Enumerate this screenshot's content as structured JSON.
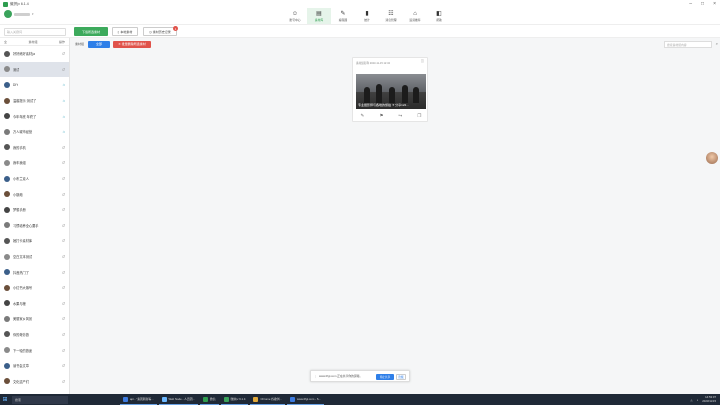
{
  "window": {
    "title": "微拼(v 6.1.4"
  },
  "header": {
    "tabs": [
      {
        "label": "账号中心",
        "icon": "person-icon",
        "glyph": "☺"
      },
      {
        "label": "素材库",
        "icon": "library-icon",
        "glyph": "▤",
        "active": true
      },
      {
        "label": "编辑器",
        "icon": "pen-icon",
        "glyph": "✎"
      },
      {
        "label": "统计",
        "icon": "chart-icon",
        "glyph": "▮"
      },
      {
        "label": "消息管理",
        "icon": "chat-icon",
        "glyph": "☷"
      },
      {
        "label": "运营推荐",
        "icon": "store-icon",
        "glyph": "⌂"
      },
      {
        "label": "帮助",
        "icon": "help-icon",
        "glyph": "◧"
      }
    ]
  },
  "toolbar": {
    "search_placeholder": "输入关键词",
    "primary_btn": "下载所选素材",
    "btn2": "本地素材",
    "btn3": "素材历史记录",
    "badge": "1"
  },
  "sidebar": {
    "col1": "全",
    "col2": "素材组",
    "col3": "操作",
    "items": [
      {
        "name": "好好练好素材(a",
        "status": "↺",
        "ok": false
      },
      {
        "name": "测试",
        "status": "↺",
        "ok": false
      },
      {
        "name": "DIY",
        "status": "⌂",
        "ok": true
      },
      {
        "name": "温馨提示 测试了",
        "status": "⌂",
        "ok": true
      },
      {
        "name": "今年年底 年终了",
        "status": "⌂",
        "ok": true
      },
      {
        "name": "万人城市经营",
        "status": "⌂",
        "ok": true
      },
      {
        "name": "我的手机",
        "status": "↺",
        "ok": false
      },
      {
        "name": "我车我组",
        "status": "↺",
        "ok": false
      },
      {
        "name": "小布兰克人",
        "status": "↺",
        "ok": false
      },
      {
        "name": "小钢炮",
        "status": "↺",
        "ok": false
      },
      {
        "name": "梦想手册",
        "status": "↺",
        "ok": false
      },
      {
        "name": "习惯培养全心要手",
        "status": "↺",
        "ok": false
      },
      {
        "name": "她打卡素材库",
        "status": "↺",
        "ok": false
      },
      {
        "name": "空白文本测试",
        "status": "↺",
        "ok": false
      },
      {
        "name": "抖音热门了",
        "status": "↺",
        "ok": false
      },
      {
        "name": "小红书大咖号",
        "status": "↺",
        "ok": false
      },
      {
        "name": "水果与粮",
        "status": "↺",
        "ok": false
      },
      {
        "name": "美丽家乡风景",
        "status": "↺",
        "ok": false
      },
      {
        "name": "你的奇妙旅",
        "status": "↺",
        "ok": false
      },
      {
        "name": "下一轮的旅途",
        "status": "↺",
        "ok": false
      },
      {
        "name": "读书会文章",
        "status": "↺",
        "ok": false
      },
      {
        "name": "文化遗产们",
        "status": "↺",
        "ok": false
      }
    ]
  },
  "main": {
    "filter_label": "素材组",
    "btn_blue": "全部",
    "btn_red": "批量删除所选素材",
    "search_placeholder": "搜索素材组内容"
  },
  "card": {
    "meta": "素材组名称 2023-11-15 12:34",
    "caption": "专业摄影师与各地的旅拍 ✈ 分享122..."
  },
  "toast": {
    "text": "www.0fgt.com 正在共享你的屏幕。",
    "stop": "停止共享",
    "hide": "隐藏"
  },
  "taskbar": {
    "search": "搜索",
    "apps": [
      {
        "label": "api - \"素团刷新等...",
        "color": "#3d7be0"
      },
      {
        "label": "Web Node - 人员团...",
        "color": "#6cb8ff"
      },
      {
        "label": "微信",
        "color": "#2e9d4f"
      },
      {
        "label": "微拼(v 6.1.4",
        "color": "#3aa35b"
      },
      {
        "label": "Chrome 谷歌浏...",
        "color": "#e0a83a"
      },
      {
        "label": "www.0fgt.com - S...",
        "color": "#3d7be0"
      }
    ],
    "time": "14:53:07",
    "date": "2023/11/15"
  }
}
